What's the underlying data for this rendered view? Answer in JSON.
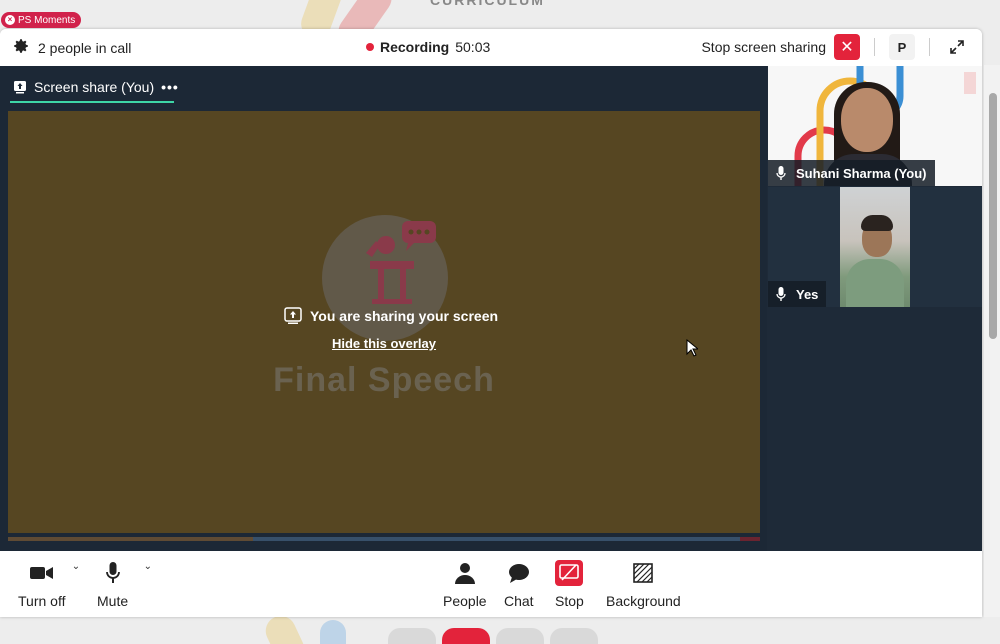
{
  "backdrop": {
    "title": "CURRICULUM"
  },
  "badge": {
    "label": "PS Moments"
  },
  "topbar": {
    "people_label": "2 people in call",
    "recording_label": "Recording",
    "recording_time": "50:03",
    "stop_share_label": "Stop screen sharing",
    "avatar_initial": "P"
  },
  "share": {
    "tab_label": "Screen share (You)",
    "tab_more": "•••",
    "overlay_message": "You are sharing your screen",
    "overlay_link": "Hide this overlay",
    "slide_title": "Final Speech"
  },
  "participants": [
    {
      "name": "Suhani Sharma (You)"
    },
    {
      "name": "Yes"
    }
  ],
  "controls": {
    "camera_label": "Turn off",
    "mute_label": "Mute",
    "people_label": "People",
    "chat_label": "Chat",
    "stop_label": "Stop",
    "background_label": "Background"
  },
  "colors": {
    "accent": "#e3233b",
    "active_tab": "#3ed6a6",
    "stage_bg": "#1c2836",
    "slide_bg": "#564622"
  }
}
